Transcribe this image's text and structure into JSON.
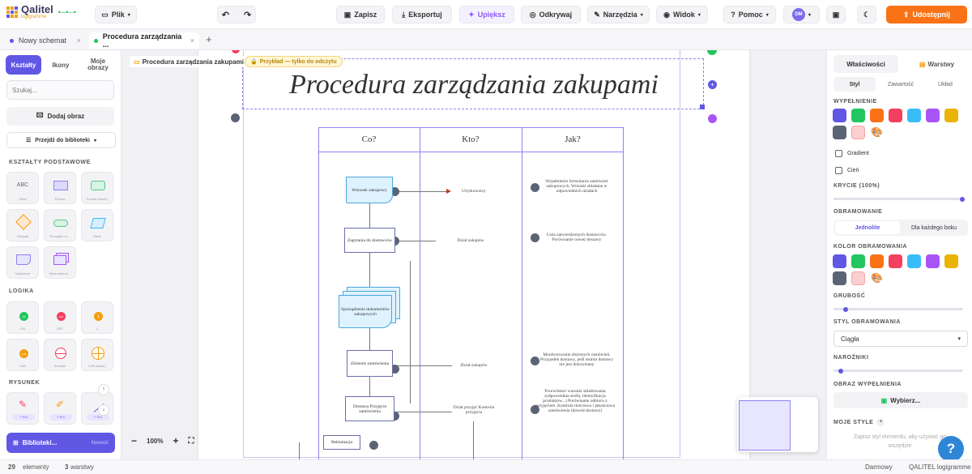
{
  "app": {
    "logo_name": "Qalitel",
    "logo_sub": "logigramme"
  },
  "toolbar": {
    "file": "Plik",
    "save": "Zapisz",
    "export": "Eksportuj",
    "beautify": "Upiększ",
    "discover": "Odkrywaj",
    "tools": "Narzędzia",
    "view": "Widok",
    "help": "Pomoc",
    "avatar": "DM",
    "share": "Udostępnij"
  },
  "tabs": [
    {
      "label": "Nowy schemat"
    },
    {
      "label": "Procedura zarządzania ..."
    }
  ],
  "left": {
    "tabs": [
      "Kształty",
      "Ikony",
      "Moje obrazy"
    ],
    "search_placeholder": "Szukaj...",
    "add_image": "Dodaj obraz",
    "browse": "Przejdź do biblioteki",
    "sections": {
      "basic": "KSZTAŁTY PODSTAWOWE",
      "logic": "LOGIKA",
      "drawing": "RYSUNEK"
    },
    "basic": [
      "Tekst",
      "Proces",
      "Proces (zaokr.)",
      "Decyzja",
      "Początek / k...",
      "Dane",
      "Dokument",
      "Wiele dokum..."
    ],
    "logic": [
      "ON",
      "OFF",
      "1",
      "LUB",
      "Sumator",
      "LUB (zaokr.)"
    ],
    "drawing": [
      "+ Pro",
      "+ Pro",
      "+ Pro"
    ],
    "libraries": "Biblioteki...",
    "libraries_badge": "Nowość"
  },
  "canvas": {
    "zoom": "100%",
    "breadcrumb": "Procedura zarządzania zakupami",
    "readonly": "Przykład — tylko do odczytu",
    "title": "Procedura zarządzania zakupami",
    "columns": [
      "Co?",
      "Kto?",
      "Jak?"
    ],
    "boxes": [
      "Wniosek zakupowy",
      "Zapytania do dostawców",
      "Sporządzenie dokumentów zakupowych",
      "Złożenie zamówienia",
      "Dostawa Przyjęcie zamówienia",
      "Reklamacja"
    ],
    "who": [
      "Użytkownicy",
      "Dział zakupów",
      "Dział zakupów",
      "Dział przyjęć Kontrola przyjęcia"
    ],
    "how": [
      "Wypełnienie formularza zamówień zakupowych. Wnioski składane w odpowiednich działach",
      "Lista zatwierdzonych dostawców. Porównanie nowej dostawy",
      "Monitorowanie złożonych zamówień. Przypadek dostawy, jeśli termin dostawy nie jest dotrzymany",
      "Przewidzieć warunki składowania (odpowiednia strefa, identyfikacja produktów...) Porównanie odbioru z przyjęciem. Kontrola ilościowa i jakościowa zamówienia (dowód dostawy)"
    ]
  },
  "right": {
    "tabs": [
      "Właściwości",
      "Warstwy"
    ],
    "subtabs": [
      "Styl",
      "Zawartość",
      "Układ"
    ],
    "fill": "WYPEŁNIENIE",
    "gradient": "Gradient",
    "shadow": "Cień",
    "opacity": "KRYCIE (100%)",
    "border": "OBRAMOWANIE",
    "border_opts": [
      "Jednolite",
      "Dla każdego boku"
    ],
    "border_color": "KOLOR OBRAMOWANIA",
    "thickness": "GRUBOŚĆ",
    "border_style": "STYL OBRAMOWANIA",
    "border_style_value": "Ciągła",
    "corners": "NAROŻNIKI",
    "fill_image": "OBRAZ WYPEŁNIENIA",
    "choose": "Wybierz...",
    "my_styles": "MOJE STYLE",
    "my_styles_hint": "Zapisz styl elementu, aby używać go wszędzie",
    "colors": [
      "#6157e5",
      "#22c55e",
      "#f97316",
      "#f43f5e",
      "#38bdf8",
      "#a855f7",
      "#eab308",
      "#5b6474",
      "#fbcfd0"
    ]
  },
  "status": {
    "elements_count": "29",
    "elements": "elementy",
    "layers_count": "3",
    "layers": "warstwy",
    "free": "Darmowy",
    "brand": "QALITEL logigramme"
  }
}
